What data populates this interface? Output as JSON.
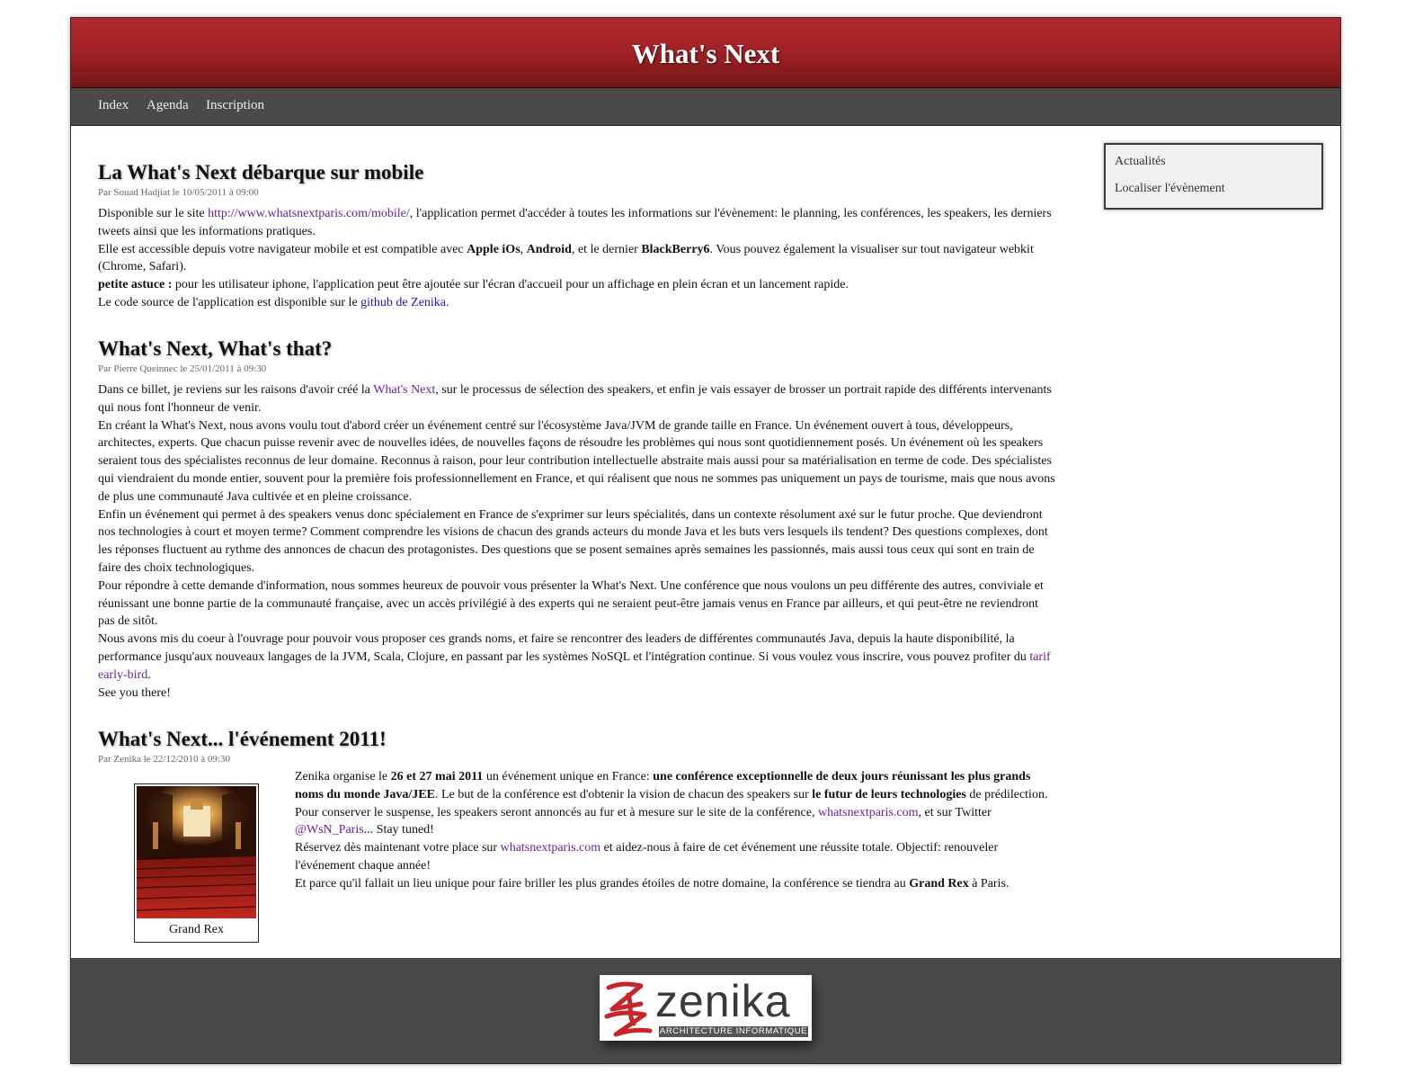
{
  "header": {
    "title": "What's Next"
  },
  "nav": {
    "items": [
      "Index",
      "Agenda",
      "Inscription"
    ]
  },
  "sidebar": {
    "items": [
      "Actualités",
      "Localiser l'évènement"
    ]
  },
  "posts": [
    {
      "title": "La What's Next débarque sur mobile",
      "meta": "Par Souad Hadjiat le 10/05/2011 à 09:00",
      "p1_before": "Disponible sur le site ",
      "p1_link": "http://www.whatsnextparis.com/mobile/",
      "p1_after": ", l'application permet d'accéder à toutes les informations sur l'évènement: le planning, les conférences, les speakers, les derniers tweets ainsi que les informations pratiques.",
      "p2_a": "Elle est accessible depuis votre navigateur mobile et est compatible avec ",
      "p2_b1": "Apple iOs",
      "p2_c": ", ",
      "p2_b2": "Android",
      "p2_d": ", et le dernier ",
      "p2_b3": "BlackBerry6",
      "p2_e": ". Vous pouvez également la visualiser sur tout navigateur webkit (Chrome, Safari).",
      "p3_bold": "petite astuce :",
      "p3_rest": " pour les utilisateur iphone, l'application peut être ajoutée sur l'écran d'accueil pour un affichage en plein écran et un lancement rapide.",
      "p4_before": "Le code source de l'application est disponible sur le ",
      "p4_link": "github de Zenika",
      "p4_after": "."
    },
    {
      "title": "What's Next, What's that?",
      "meta": "Par Pierre Queinnec le 25/01/2011 à 09:30",
      "p1_before": "Dans ce billet, je reviens sur les raisons d'avoir créé la ",
      "p1_link": "What's Next",
      "p1_after": ", sur le processus de sélection des speakers, et enfin je vais essayer de brosser un portrait rapide des différents intervenants qui nous font l'honneur de venir.",
      "p2": "En créant la What's Next, nous avons voulu tout d'abord créer un événement centré sur l'écosystème Java/JVM de grande taille en France. Un événement ouvert à tous, développeurs, architectes, experts. Que chacun puisse revenir avec de nouvelles idées, de nouvelles façons de résoudre les problèmes qui nous sont quotidiennement posés. Un événement où les speakers seraient tous des spécialistes reconnus de leur domaine. Reconnus à raison, pour leur contribution intellectuelle abstraite mais aussi pour sa matérialisation en terme de code. Des spécialistes qui viendraient du monde entier, souvent pour la première fois professionnellement en France, et qui réalisent que nous ne sommes pas uniquement un pays de tourisme, mais que nous avons de plus une communauté Java cultivée et en pleine croissance.",
      "p3": "Enfin un événement qui permet à des speakers venus donc spécialement en France de s'exprimer sur leurs spécialités, dans un contexte résolument axé sur le futur proche. Que deviendront nos technologies à court et moyen terme? Comment comprendre les visions de chacun des grands acteurs du monde Java et les buts vers lesquels ils tendent? Des questions complexes, dont les réponses fluctuent au rythme des annonces de chacun des protagonistes. Des questions que se posent semaines après semaines les passionnés, mais aussi tous ceux qui sont en train de faire des choix technologiques.",
      "p4": "Pour répondre à cette demande d'information, nous sommes heureux de pouvoir vous présenter la What's Next. Une conférence que nous voulons un peu différente des autres, conviviale et réunissant une bonne partie de la communauté française, avec un accès privilégié à des experts qui ne seraient peut-être jamais venus en France par ailleurs, et qui peut-être ne reviendront pas de sitôt.",
      "p5_before": "Nous avons mis du coeur à l'ouvrage pour pouvoir vous proposer ces grands noms, et faire se rencontrer des leaders de différentes communautés Java, depuis la haute disponibilité, la performance jusqu'aux nouveaux langages de la JVM, Scala, Clojure, en passant par les systèmes NoSQL et l'intégration continue. Si vous voulez vous inscrire, vous pouvez profiter du ",
      "p5_link": "tarif early-bird",
      "p5_after": ".",
      "p6": "See you there!"
    },
    {
      "title": "What's Next... l'événement 2011!",
      "meta": "Par Zenika le 22/12/2010 à 09:30",
      "figure_caption": "Grand Rex",
      "p1_a": "Zenika organise le ",
      "p1_b1": "26 et 27 mai 2011",
      "p1_c": " un événement unique en France: ",
      "p1_b2": "une conférence exceptionnelle de deux jours réunissant les plus grands noms du monde Java/JEE",
      "p1_d": ". Le but de la conférence est d'obtenir la vision de chacun des speakers sur ",
      "p1_b3": "le futur de leurs technologies",
      "p1_e": " de prédilection.",
      "p2_a": "Pour conserver le suspense, les speakers seront annoncés au fur et à mesure sur le site de la conférence, ",
      "p2_link1": "whatsnextparis.com",
      "p2_b": ", et sur Twitter ",
      "p2_link2": "@WsN_Paris",
      "p2_c": "... Stay tuned!",
      "p3_a": "Réservez dès maintenant votre place sur ",
      "p3_link": "whatsnextparis.com",
      "p3_b": " et aidez-nous à faire de cet événement une réussite totale. Objectif: renouveler l'événement chaque année!",
      "p4_a": "Et parce qu'il fallait un lieu unique pour faire briller les plus grandes étoiles de notre domaine, la conférence se tiendra au ",
      "p4_b": "Grand Rex",
      "p4_c": " à Paris."
    }
  ],
  "footer": {
    "logo_word": "zenika",
    "logo_sub": "ARCHITECTURE INFORMATIQUE"
  },
  "colors": {
    "header_red": "#a02227",
    "nav_gray": "#4a4a4a",
    "link_purple": "#6a1fa0",
    "link_blue": "#1a14c8"
  }
}
